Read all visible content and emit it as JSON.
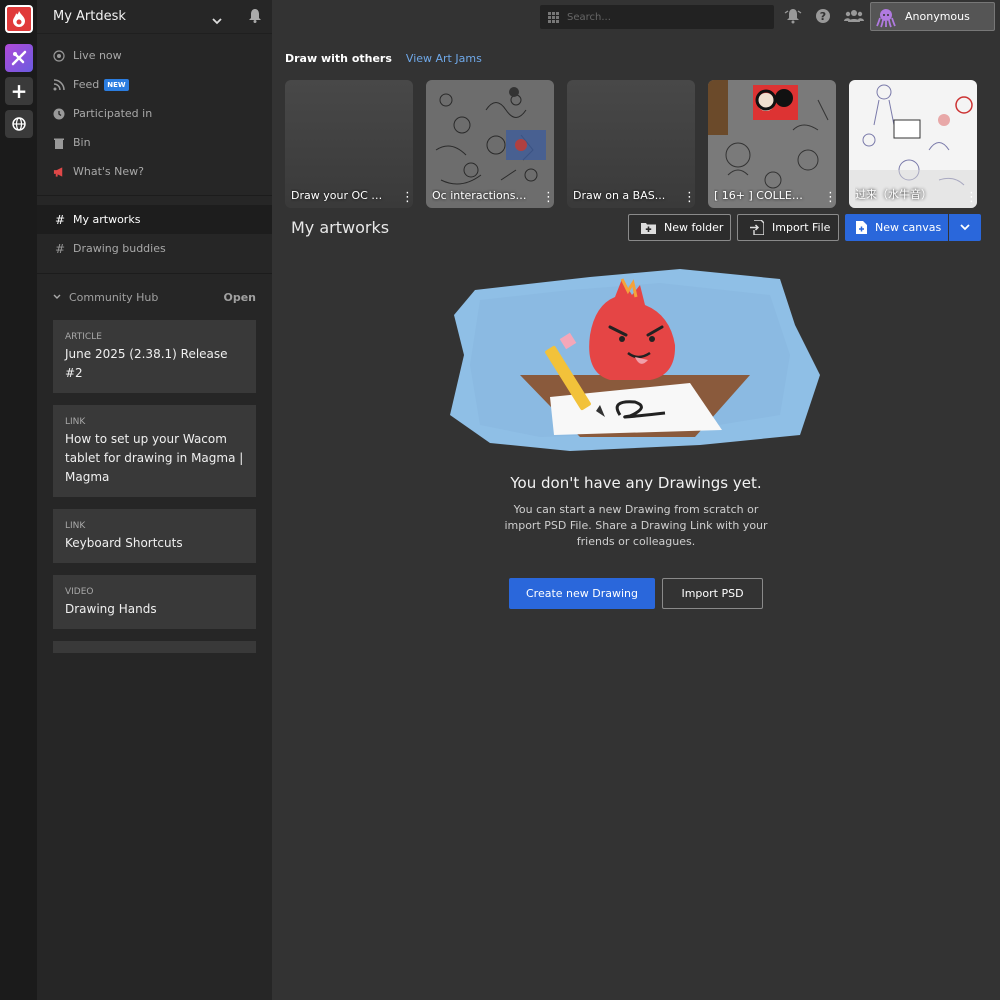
{
  "sidebar": {
    "title": "My Artdesk",
    "nav": [
      {
        "label": "Live now",
        "icon": "broadcast-icon"
      },
      {
        "label": "Feed",
        "icon": "rss-icon",
        "badge": "NEW"
      },
      {
        "label": "Participated in",
        "icon": "clock-icon"
      },
      {
        "label": "Bin",
        "icon": "trash-icon"
      },
      {
        "label": "What's New?",
        "icon": "megaphone-icon"
      }
    ],
    "channels": [
      {
        "label": "My artworks",
        "active": true
      },
      {
        "label": "Drawing buddies",
        "active": false
      }
    ],
    "hub": {
      "title": "Community Hub",
      "open_label": "Open",
      "cards": [
        {
          "kind": "ARTICLE",
          "text": "June 2025 (2.38.1) Release #2"
        },
        {
          "kind": "LINK",
          "text": "How to set up your Wacom tablet for drawing in Magma | Magma"
        },
        {
          "kind": "LINK",
          "text": "Keyboard Shortcuts"
        },
        {
          "kind": "VIDEO",
          "text": "Drawing Hands"
        }
      ]
    }
  },
  "topbar": {
    "search_placeholder": "Search...",
    "user_name": "Anonymous"
  },
  "jams": {
    "title": "Draw with others",
    "link": "View Art Jams",
    "items": [
      {
        "label": "Draw your OC a..."
      },
      {
        "label": "Oc interactions/..."
      },
      {
        "label": "Draw on a BAS..."
      },
      {
        "label": "[ 16+ ] COLLEGE..."
      },
      {
        "label": "过来（水牛音）"
      }
    ]
  },
  "artworks": {
    "title": "My artworks",
    "new_folder": "New folder",
    "import_file": "Import File",
    "new_canvas": "New canvas"
  },
  "empty": {
    "title": "You don't have any Drawings yet.",
    "description": "You can start a new Drawing from scratch or import PSD File. Share a Drawing Link with your friends or colleagues.",
    "create_label": "Create new Drawing",
    "import_label": "Import PSD"
  },
  "colors": {
    "accent": "#2a67db",
    "brand": "#e03a3a",
    "link": "#6fa8e8"
  }
}
